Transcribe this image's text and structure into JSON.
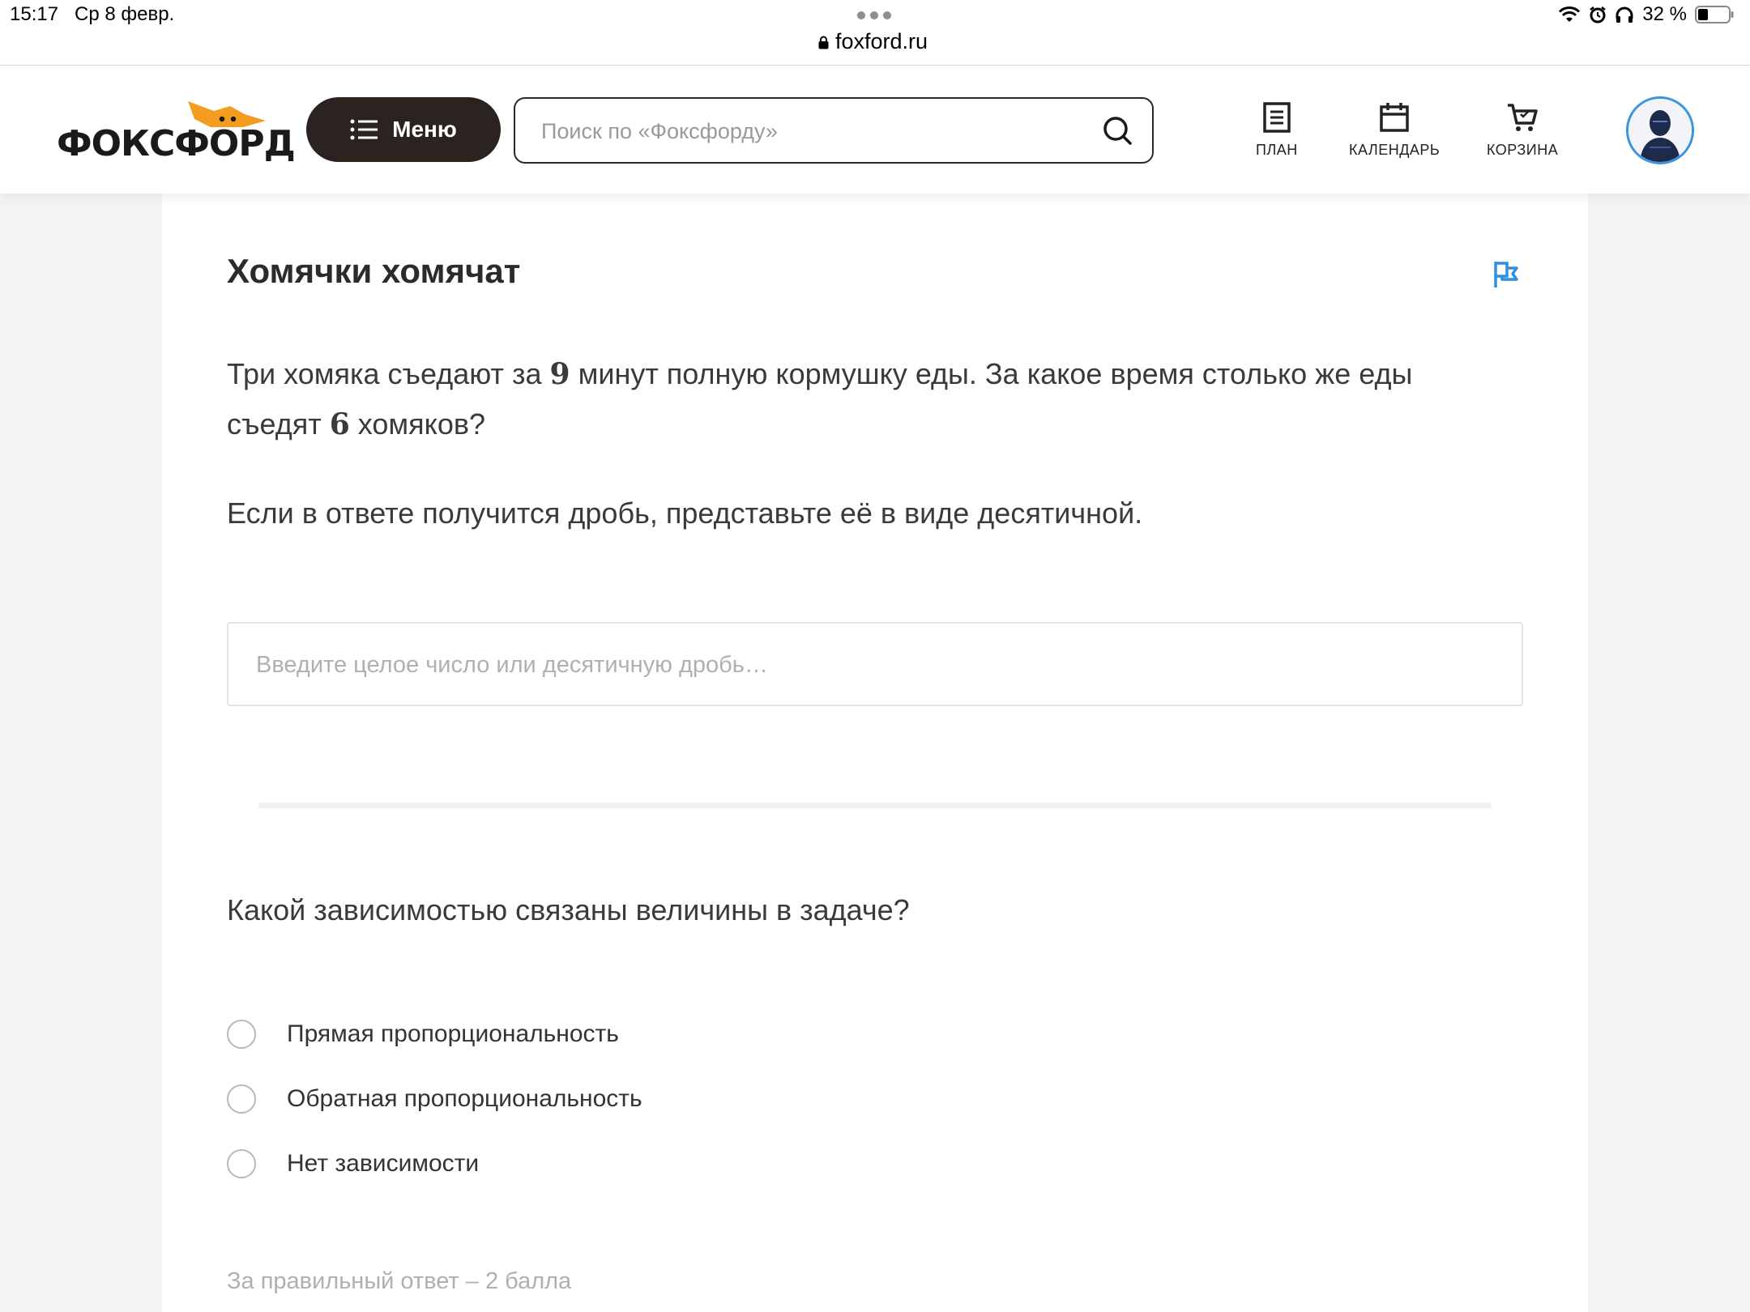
{
  "status_bar": {
    "time": "15:17",
    "date": "Ср 8 февр.",
    "url": "foxford.ru",
    "battery": "32 %"
  },
  "header": {
    "logo_text": "ФОКСФОРД",
    "menu_label": "Меню",
    "search_placeholder": "Поиск по «Фоксфорду»",
    "nav": {
      "plan": "ПЛАН",
      "calendar": "КАЛЕНДАРЬ",
      "cart": "КОРЗИНА"
    }
  },
  "task": {
    "title": "Хомячки хомячат",
    "problem_part1": "Три хомяка съедают за ",
    "minutes": "9",
    "problem_part2": " минут полную кормушку еды. За какое время столько же еды съедят ",
    "hamsters": "6",
    "problem_part3": " хомяков?",
    "hint": "Если в ответе получится дробь, представьте её в виде десятичной.",
    "answer_placeholder": "Введите целое число или десятичную дробь…",
    "question": "Какой зависимостью связаны величины в задаче?",
    "options": [
      "Прямая пропорциональность",
      "Обратная пропорциональность",
      "Нет зависимости"
    ],
    "score_note": "За правильный ответ – 2 балла"
  },
  "colors": {
    "accent_blue": "#3a94e0",
    "logo_orange": "#f39c1f",
    "menu_dark": "#2a2320"
  }
}
